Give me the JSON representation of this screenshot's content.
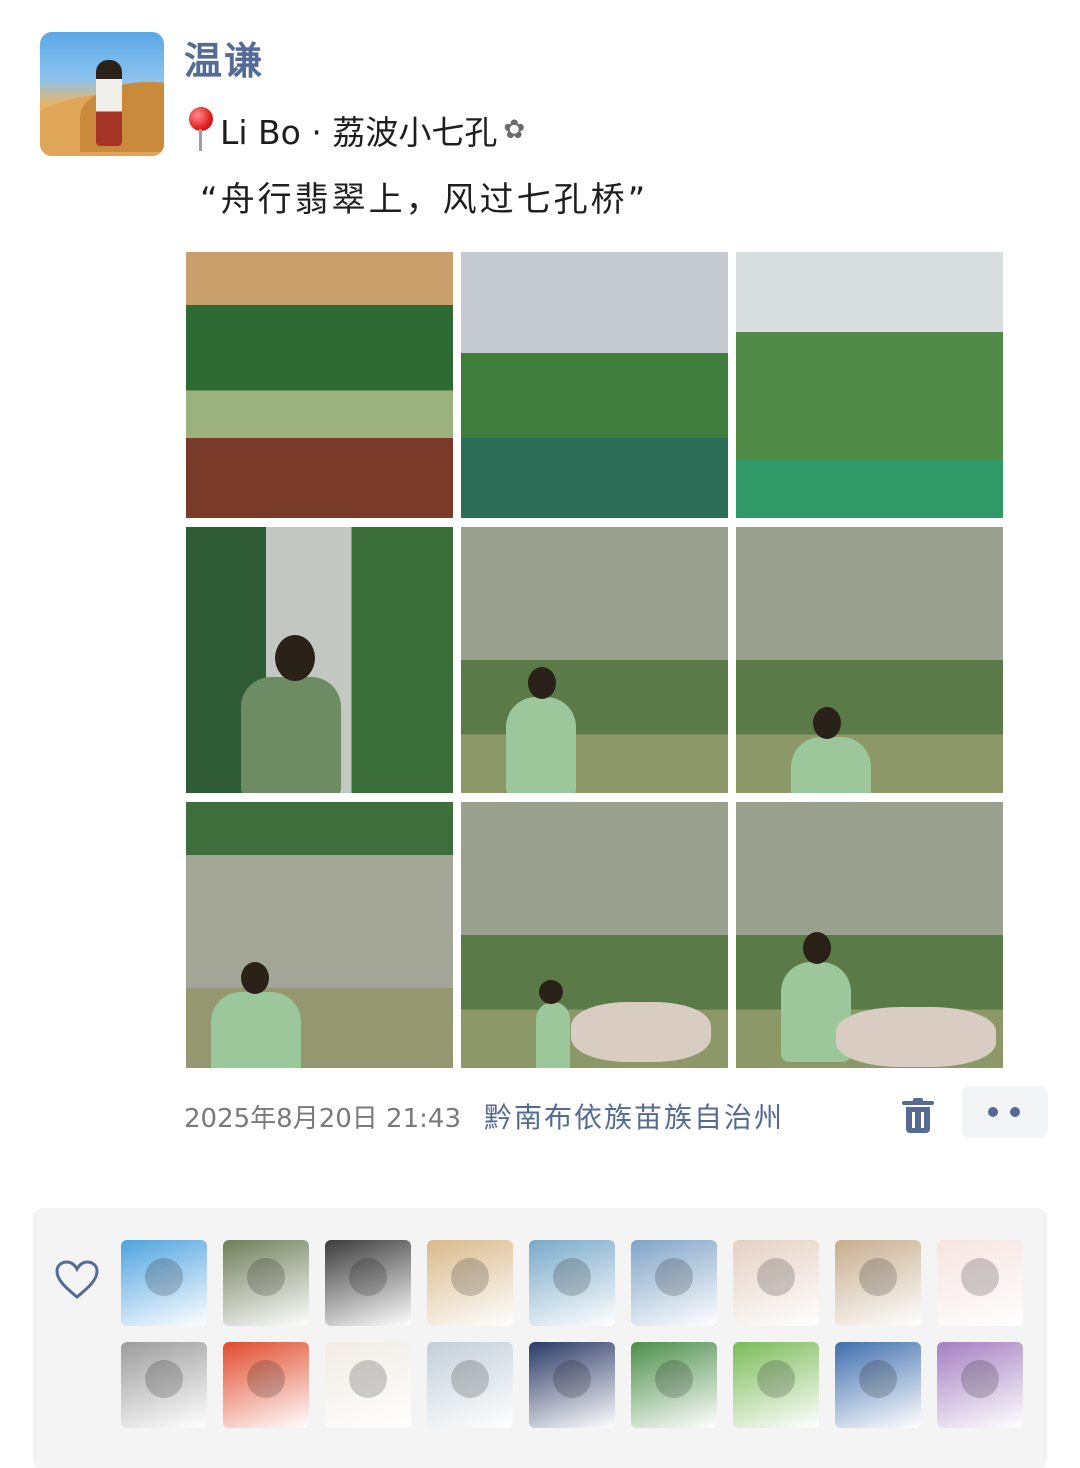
{
  "post": {
    "username": "温谦",
    "location_tag": "Li Bo · 荔波小七孔",
    "caption": "“舟行翡翠上，风过七孔桥”",
    "date": "2025年8月20日 21:43",
    "place": "黔南布依族苗族自治州"
  },
  "photos": [
    {
      "name": "photo-boat-ride"
    },
    {
      "name": "photo-bridge-crowd"
    },
    {
      "name": "photo-green-lake"
    },
    {
      "name": "photo-valley-back"
    },
    {
      "name": "photo-cave-cliff-1"
    },
    {
      "name": "photo-cave-cliff-2"
    },
    {
      "name": "photo-cliff-river"
    },
    {
      "name": "photo-rock-stone-1"
    },
    {
      "name": "photo-rock-stone-2"
    }
  ],
  "likes": [
    {
      "color": "#4fa3e0"
    },
    {
      "color": "#6f7d5a"
    },
    {
      "color": "#3b3b3b"
    },
    {
      "color": "#d9b98a"
    },
    {
      "color": "#78a9c9"
    },
    {
      "color": "#7fa4c7"
    },
    {
      "color": "#e6d0c3"
    },
    {
      "color": "#c7ad8e"
    },
    {
      "color": "#f7e3e1"
    },
    {
      "color": "#9c9c9c"
    },
    {
      "color": "#e04b2c"
    },
    {
      "color": "#f1ece4"
    },
    {
      "color": "#c3cfd8"
    },
    {
      "color": "#2b3a66"
    },
    {
      "color": "#4c8e4a"
    },
    {
      "color": "#7bbb5a"
    },
    {
      "color": "#3f6fae"
    },
    {
      "color": "#a57ec2"
    }
  ],
  "icons": {
    "heart": "heart-icon",
    "delete": "trash-icon",
    "more": "more-icon",
    "location": "pin-icon"
  },
  "colors": {
    "accent": "#556b95",
    "panel_bg": "#f4f4f4"
  }
}
